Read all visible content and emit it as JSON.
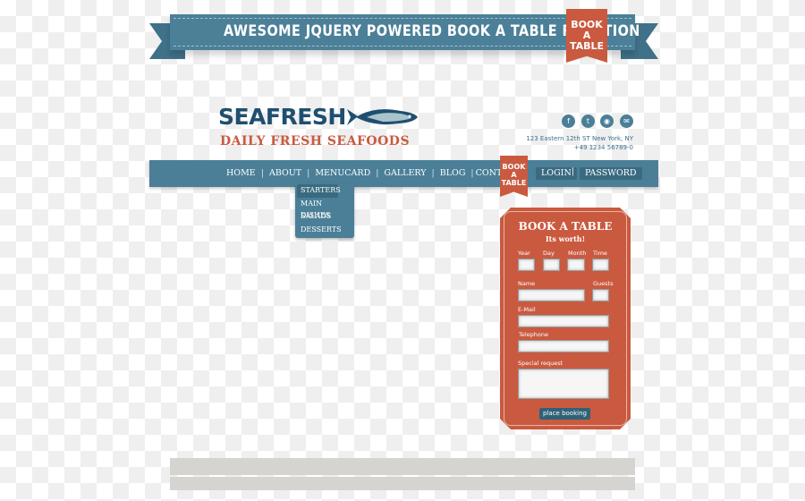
{
  "banner": {
    "title": "AWESOME JQUERY POWERED BOOK A TABLE FUNCTION",
    "tag": "BOOK A TABLE"
  },
  "brand": {
    "name": "SEAFRESH",
    "tagline": "DAILY FRESH SEAFOODS"
  },
  "social": [
    {
      "icon": "facebook-icon",
      "glyph": "f"
    },
    {
      "icon": "twitter-icon",
      "glyph": "t"
    },
    {
      "icon": "rss-icon",
      "glyph": "◉"
    },
    {
      "icon": "email-icon",
      "glyph": "✉"
    }
  ],
  "contact": {
    "address": "123 Eastern 12th ST New York, NY",
    "phone": "+49 1234 56789-0"
  },
  "nav": {
    "items": [
      "HOME",
      "ABOUT",
      "MENUCARD",
      "GALLERY",
      "BLOG",
      "CONTACT"
    ],
    "tag": "BOOK A TABLE",
    "login": "LOGIN",
    "password": "PASSWORD"
  },
  "dropdown": [
    "STARTERS",
    "MAIN DISHES",
    "SALADS",
    "DESSERTS"
  ],
  "form": {
    "title": "BOOK A TABLE",
    "subtitle": "Its worth!",
    "year": "Year",
    "day": "Day",
    "month": "Month",
    "time": "Time",
    "name": "Name",
    "guests": "Guests",
    "email": "E-Mail",
    "telephone": "Telephone",
    "request": "Special request",
    "submit": "place booking"
  },
  "colors": {
    "blue": "#4a7f97",
    "red": "#c95a3f",
    "navy": "#1f4f70"
  }
}
